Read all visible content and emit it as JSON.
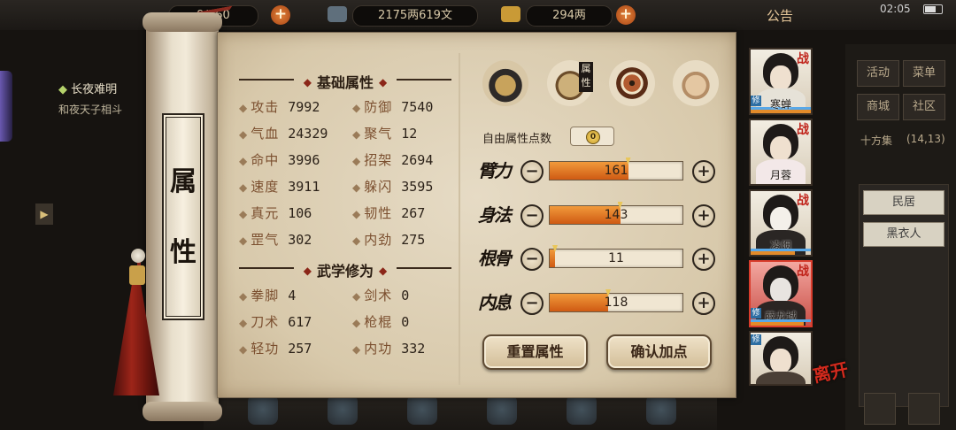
{
  "topbar": {
    "storage": "9/360",
    "money": "2175两619文",
    "ingot": "294两",
    "notice": "公告",
    "time": "02:05"
  },
  "quest": {
    "title": "长夜难明",
    "subtitle": "和夜天子相斗"
  },
  "right_menu": {
    "buttons": [
      "活动",
      "菜单",
      "商城",
      "社区"
    ],
    "location": "十方集",
    "coords": "(14,13)",
    "list": [
      "民居",
      "黑衣人"
    ]
  },
  "scroll_title": [
    "属",
    "性"
  ],
  "base_section": {
    "title": "基础属性",
    "stats": [
      {
        "label": "攻击",
        "value": "7992"
      },
      {
        "label": "防御",
        "value": "7540"
      },
      {
        "label": "气血",
        "value": "24329"
      },
      {
        "label": "聚气",
        "value": "12"
      },
      {
        "label": "命中",
        "value": "3996"
      },
      {
        "label": "招架",
        "value": "2694"
      },
      {
        "label": "速度",
        "value": "3911"
      },
      {
        "label": "躲闪",
        "value": "3595"
      },
      {
        "label": "真元",
        "value": "106"
      },
      {
        "label": "韧性",
        "value": "267"
      },
      {
        "label": "罡气",
        "value": "302"
      },
      {
        "label": "内劲",
        "value": "275"
      }
    ]
  },
  "martial_section": {
    "title": "武学修为",
    "stats": [
      {
        "label": "拳脚",
        "value": "4"
      },
      {
        "label": "剑术",
        "value": "0"
      },
      {
        "label": "刀术",
        "value": "617"
      },
      {
        "label": "枪棍",
        "value": "0"
      },
      {
        "label": "轻功",
        "value": "257"
      },
      {
        "label": "内功",
        "value": "332"
      }
    ]
  },
  "tabs": {
    "active_tag": "属性",
    "icons": [
      "hat-icon",
      "attribute-icon",
      "bagua-icon",
      "body-icon"
    ]
  },
  "free_points": {
    "label": "自由属性点数",
    "value": "0"
  },
  "attributes": [
    {
      "label": "臂力",
      "value": "161",
      "fill": 0.59
    },
    {
      "label": "身法",
      "value": "143",
      "fill": 0.53
    },
    {
      "label": "根骨",
      "value": "11",
      "fill": 0.04
    },
    {
      "label": "内息",
      "value": "118",
      "fill": 0.44
    }
  ],
  "buttons": {
    "reset": "重置属性",
    "confirm": "确认加点"
  },
  "party": [
    {
      "name": "寒蝉",
      "tag": "战",
      "selected": false
    },
    {
      "name": "月蓉",
      "tag": "战",
      "selected": false
    },
    {
      "name": "凌烟",
      "tag": "战",
      "selected": false
    },
    {
      "name": "薛龙城",
      "tag": "战",
      "selected": true
    },
    {
      "name": "",
      "tag": "",
      "selected": false
    }
  ],
  "leave_label": "离开",
  "colors": {
    "accent_red": "#8b2618",
    "bar_fill": "#e07020",
    "paper": "#d8c9ab"
  }
}
